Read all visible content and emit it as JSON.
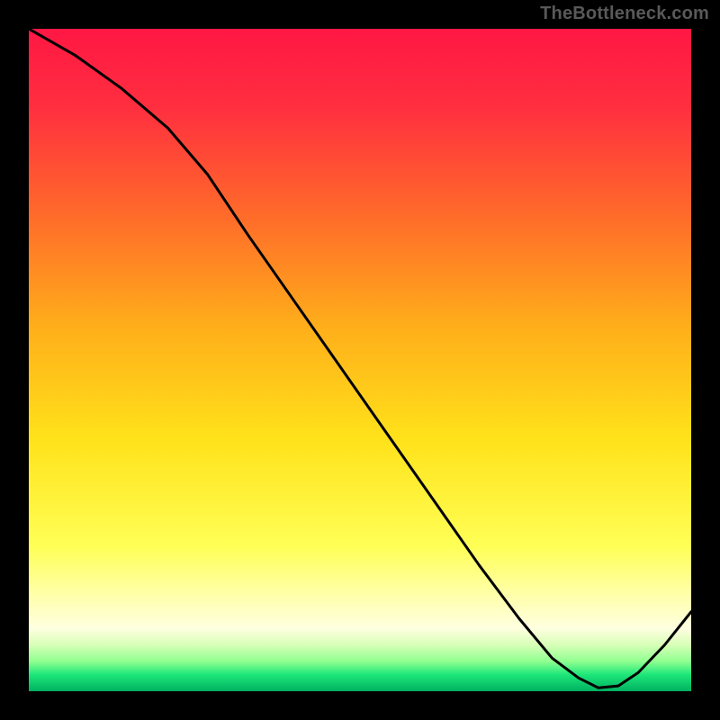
{
  "watermark": "TheBottleneck.com",
  "dot_label": "",
  "chart_data": {
    "type": "line",
    "title": "",
    "xlabel": "",
    "ylabel": "",
    "xlim": [
      0,
      100
    ],
    "ylim": [
      0,
      100
    ],
    "grid": false,
    "legend": false,
    "background_gradient": [
      {
        "stop": 0.0,
        "color": "#ff1744"
      },
      {
        "stop": 0.12,
        "color": "#ff2f3f"
      },
      {
        "stop": 0.28,
        "color": "#ff6a2a"
      },
      {
        "stop": 0.45,
        "color": "#ffae1a"
      },
      {
        "stop": 0.62,
        "color": "#ffe21a"
      },
      {
        "stop": 0.78,
        "color": "#ffff55"
      },
      {
        "stop": 0.86,
        "color": "#ffffb0"
      },
      {
        "stop": 0.905,
        "color": "#ffffe0"
      },
      {
        "stop": 0.93,
        "color": "#d8ffb8"
      },
      {
        "stop": 0.955,
        "color": "#90ff90"
      },
      {
        "stop": 0.975,
        "color": "#1de77a"
      },
      {
        "stop": 1.0,
        "color": "#00b060"
      }
    ],
    "series": [
      {
        "name": "curve",
        "color": "#000000",
        "stroke_width": 3,
        "x": [
          0,
          7,
          14,
          21,
          27,
          33,
          40,
          47,
          54,
          61,
          68,
          74,
          79,
          83,
          86,
          89,
          92,
          96,
          100
        ],
        "y": [
          100,
          96,
          91,
          85,
          78,
          69,
          59,
          49,
          39,
          29,
          19,
          11,
          5,
          2,
          0.5,
          0.8,
          2.8,
          7.0,
          12
        ]
      }
    ],
    "annotations": [
      {
        "type": "dot-label",
        "text": "",
        "x": 84,
        "y": 3
      }
    ]
  }
}
